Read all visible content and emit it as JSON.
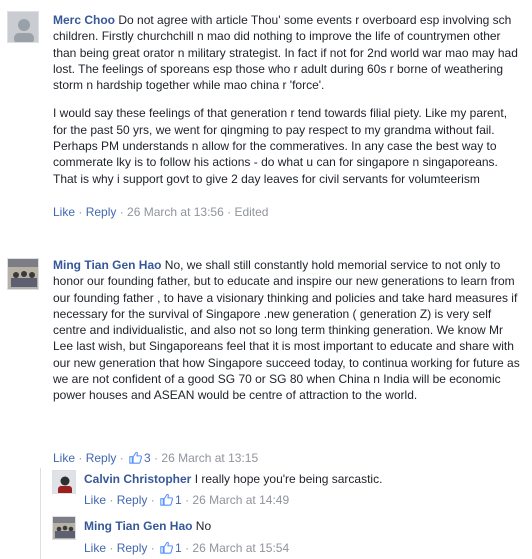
{
  "comments": [
    {
      "author": "Merc Choo",
      "paragraphs": [
        "Do not agree with article Thou' some events r overboard esp involving sch children. Firstly churchchill n mao did nothing to improve the life of countrymen other than being great orator n military strategist. In fact if not for 2nd world war mao may had lost. The feelings of sporeans esp those who r adult during 60s r borne of weathering storm n hardship together while mao china r 'force'.",
        "I would say these feelings of that generation r tend towards filial piety. Like my parent, for the past 50 yrs, we went for qingming to pay respect to my grandma without fail. Perhaps PM understands n allow for the commeratives. In any case the best way to commerate lky is to follow his actions - do what u can for singapore n singaporeans. That is why i support govt to give 2 day leaves for civil servants for volumteerism"
      ],
      "like_label": "Like",
      "reply_label": "Reply",
      "time": "26 March at 13:56",
      "edited": "Edited"
    },
    {
      "author": "Ming Tian Gen Hao",
      "paragraphs": [
        "No, we shall still constantly hold memorial service to not only to honor our founding father, but to educate and inspire our new generations to learn from our founding father , to have a visionary thinking and policies and take hard measures if necessary for the survival of Singapore .new generation ( generation Z) is very self centre and individualistic, and also not so long term thinking generation. We know Mr Lee last wish, but Singaporeans feel that it is most important to educate and share with our new generation that how Singapore succeed today, to continua working for future as we are not confident of a good SG 70 or SG 80 when China n India will be economic power houses and ASEAN would be centre of attraction to the world."
      ],
      "like_label": "Like",
      "reply_label": "Reply",
      "likes": "3",
      "time": "26 March at 13:15"
    }
  ],
  "replies": [
    {
      "author": "Calvin Christopher",
      "text": "I really hope you're being sarcastic.",
      "like_label": "Like",
      "reply_label": "Reply",
      "likes": "1",
      "time": "26 March at 14:49"
    },
    {
      "author": "Ming Tian Gen Hao",
      "text": "No",
      "like_label": "Like",
      "reply_label": "Reply",
      "likes": "1",
      "time": "26 March at 15:54"
    }
  ],
  "colors": {
    "name": "#365899",
    "link": "#4267b2",
    "meta": "#90949c",
    "like_badge": "#5890ff"
  },
  "icons": {
    "like_badge": "thumbs-up-icon"
  }
}
